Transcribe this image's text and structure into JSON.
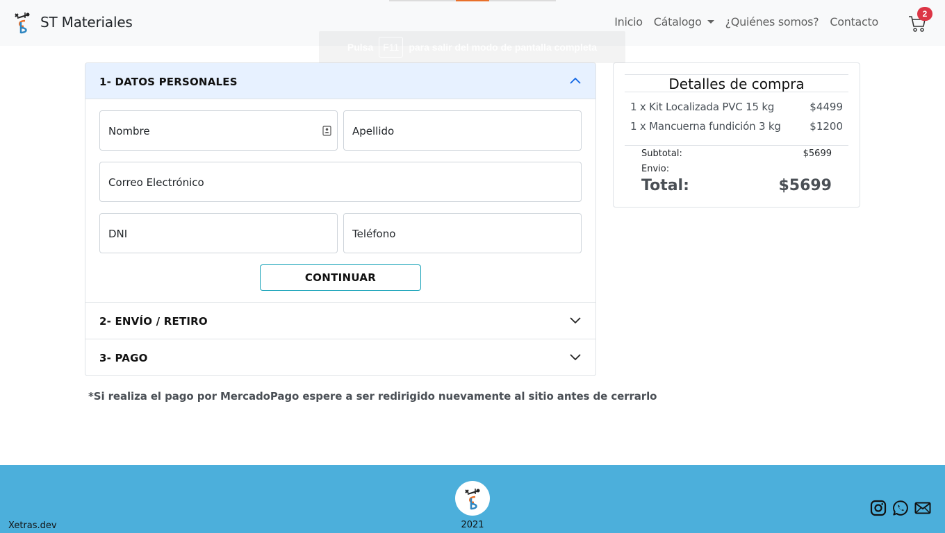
{
  "navbar": {
    "brand": "ST Materiales",
    "links": [
      "Inicio",
      "Cátalogo",
      "¿Quiénes somos?",
      "Contacto"
    ],
    "cart_count": "2"
  },
  "toast": {
    "before": "Pulsa",
    "key": "F11",
    "after": "para salir del modo de pantalla completa"
  },
  "checkout": {
    "section1": {
      "title": "1- DATOS PERSONALES",
      "fields": {
        "nombre": "Nombre",
        "apellido": "Apellido",
        "correo": "Correo Electrónico",
        "dni": "DNI",
        "telefono": "Teléfono"
      },
      "continue_label": "CONTINUAR"
    },
    "section2": {
      "title": "2- ENVÍO / RETIRO"
    },
    "section3": {
      "title": "3- PAGO"
    },
    "note": "*Si realiza el pago por MercadoPago espere a ser redirigido nuevamente al sitio antes de cerrarlo"
  },
  "summary": {
    "title": "Detalles de compra",
    "items": [
      {
        "name": "1 x Kit Localizada PVC 15 kg",
        "price": "$4499"
      },
      {
        "name": "1 x Mancuerna fundición 3 kg",
        "price": "$1200"
      }
    ],
    "subtotal_label": "Subtotal:",
    "subtotal_value": "$5699",
    "envio_label": "Envio:",
    "envio_value": "",
    "total_label": "Total:",
    "total_value": "$5699"
  },
  "footer": {
    "credit": "Xetras.dev",
    "year": "2021",
    "social_icons": [
      "instagram-icon",
      "whatsapp-icon",
      "mail-icon"
    ]
  },
  "colors": {
    "accent_active_bg": "#e7f1ff",
    "button_border": "#17a2b8",
    "badge": "#dc3545",
    "footer_bg": "#4cafdb",
    "logo_orange": "#e8702a",
    "logo_blue": "#2e86c1"
  }
}
